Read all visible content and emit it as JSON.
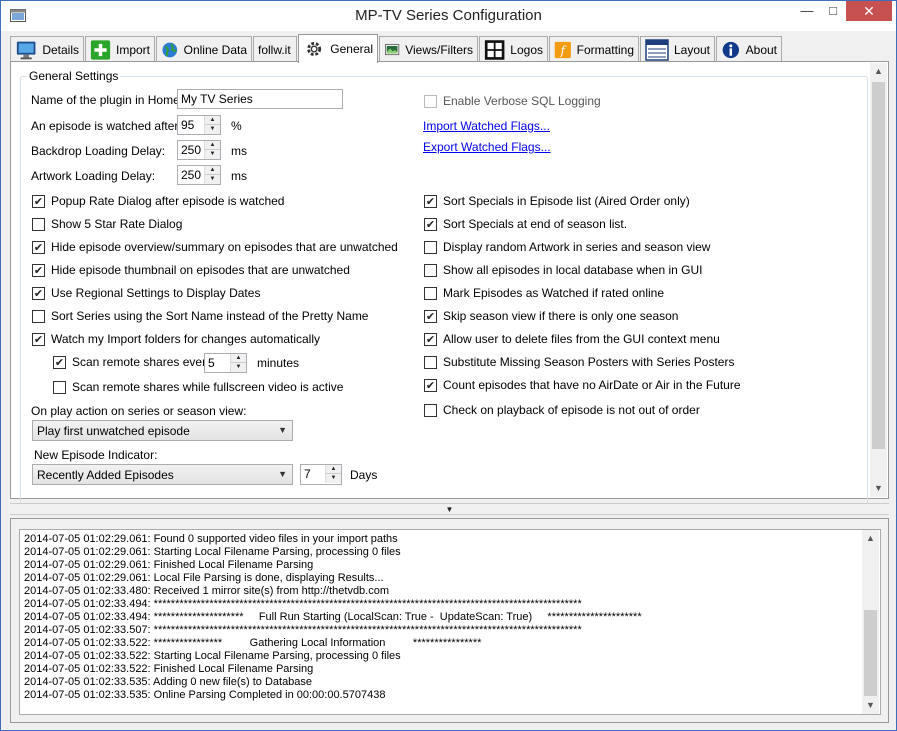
{
  "window": {
    "title": "MP-TV Series Configuration"
  },
  "tabs": [
    {
      "label": "Details",
      "icon": "monitor-icon"
    },
    {
      "label": "Import",
      "icon": "plus-icon"
    },
    {
      "label": "Online Data",
      "icon": "globe-icon"
    },
    {
      "label": "follw.it",
      "icon": ""
    },
    {
      "label": "General",
      "icon": "gear-icon"
    },
    {
      "label": "Views/Filters",
      "icon": "filter-image-icon"
    },
    {
      "label": "Logos",
      "icon": "grid-icon"
    },
    {
      "label": "Formatting",
      "icon": "script-f-icon"
    },
    {
      "label": "Layout",
      "icon": "layout-icon"
    },
    {
      "label": "About",
      "icon": "info-icon"
    }
  ],
  "general": {
    "group_title": "General Settings",
    "plugin_name_label": "Name of the plugin in Home:",
    "plugin_name_value": "My TV Series",
    "watched_after_label": "An episode is watched after:",
    "watched_after_value": "95",
    "watched_after_unit": "%",
    "backdrop_delay_label": "Backdrop Loading Delay:",
    "backdrop_delay_value": "250",
    "backdrop_delay_unit": "ms",
    "artwork_delay_label": "Artwork Loading Delay:",
    "artwork_delay_value": "250",
    "artwork_delay_unit": "ms",
    "verbose_sql": {
      "label": "Enable Verbose SQL Logging",
      "checked": false
    },
    "import_watched_link": "Import Watched Flags...",
    "export_watched_link": "Export Watched Flags...",
    "left_checks": [
      {
        "label": "Popup Rate Dialog after episode is watched",
        "checked": true
      },
      {
        "label": "Show 5 Star Rate Dialog",
        "checked": false
      },
      {
        "label": "Hide episode overview/summary on episodes that are unwatched",
        "checked": true
      },
      {
        "label": "Hide episode thumbnail on episodes that are unwatched",
        "checked": true
      },
      {
        "label": "Use Regional Settings to Display Dates",
        "checked": true
      },
      {
        "label": "Sort Series using the Sort Name instead of the Pretty Name",
        "checked": false
      },
      {
        "label": "Watch my Import folders for changes automatically",
        "checked": true
      }
    ],
    "scan_remote": {
      "label": "Scan remote shares every",
      "checked": true,
      "value": "5",
      "unit": "minutes"
    },
    "scan_fullscreen": {
      "label": "Scan remote shares while fullscreen video is active",
      "checked": false
    },
    "right_checks": [
      {
        "label": "Sort Specials in Episode list (Aired Order only)",
        "checked": true
      },
      {
        "label": "Sort Specials at end of season list.",
        "checked": true
      },
      {
        "label": "Display random Artwork in series and season view",
        "checked": false
      },
      {
        "label": "Show all episodes in local database when in GUI",
        "checked": false
      },
      {
        "label": "Mark Episodes as Watched if rated online",
        "checked": false
      },
      {
        "label": "Skip season view if there is only one season",
        "checked": true
      },
      {
        "label": "Allow user to delete files from the GUI context menu",
        "checked": true
      },
      {
        "label": "Substitute Missing Season Posters with Series Posters",
        "checked": false
      },
      {
        "label": "Count episodes that have no AirDate or Air in the Future",
        "checked": true
      },
      {
        "label": "Check on playback of episode is not out of order",
        "checked": false
      }
    ],
    "play_action_label": "On play action on series or season view:",
    "play_action_value": "Play first unwatched episode",
    "new_episode_label": "New Episode Indicator:",
    "new_episode_value": "Recently Added Episodes",
    "new_episode_days_value": "7",
    "new_episode_days_unit": "Days"
  },
  "log": [
    "2014-07-05 01:02:29.061: Found 0 supported video files in your import paths",
    "2014-07-05 01:02:29.061: Starting Local Filename Parsing, processing 0 files",
    "2014-07-05 01:02:29.061: Finished Local Filename Parsing",
    "2014-07-05 01:02:29.061: Local File Parsing is done, displaying Results...",
    "2014-07-05 01:02:33.480: Received 1 mirror site(s) from http://thetvdb.com",
    "2014-07-05 01:02:33.494: ****************************************************************************************************",
    "2014-07-05 01:02:33.494: *********************     Full Run Starting (LocalScan: True -  UpdateScan: True)     **********************",
    "2014-07-05 01:02:33.507: ****************************************************************************************************",
    "2014-07-05 01:02:33.522: ****************         Gathering Local Information         ****************",
    "2014-07-05 01:02:33.522: Starting Local Filename Parsing, processing 0 files",
    "2014-07-05 01:02:33.522: Finished Local Filename Parsing",
    "2014-07-05 01:02:33.535: Adding 0 new file(s) to Database",
    "2014-07-05 01:02:33.535: Online Parsing Completed in 00:00:00.5707438"
  ]
}
